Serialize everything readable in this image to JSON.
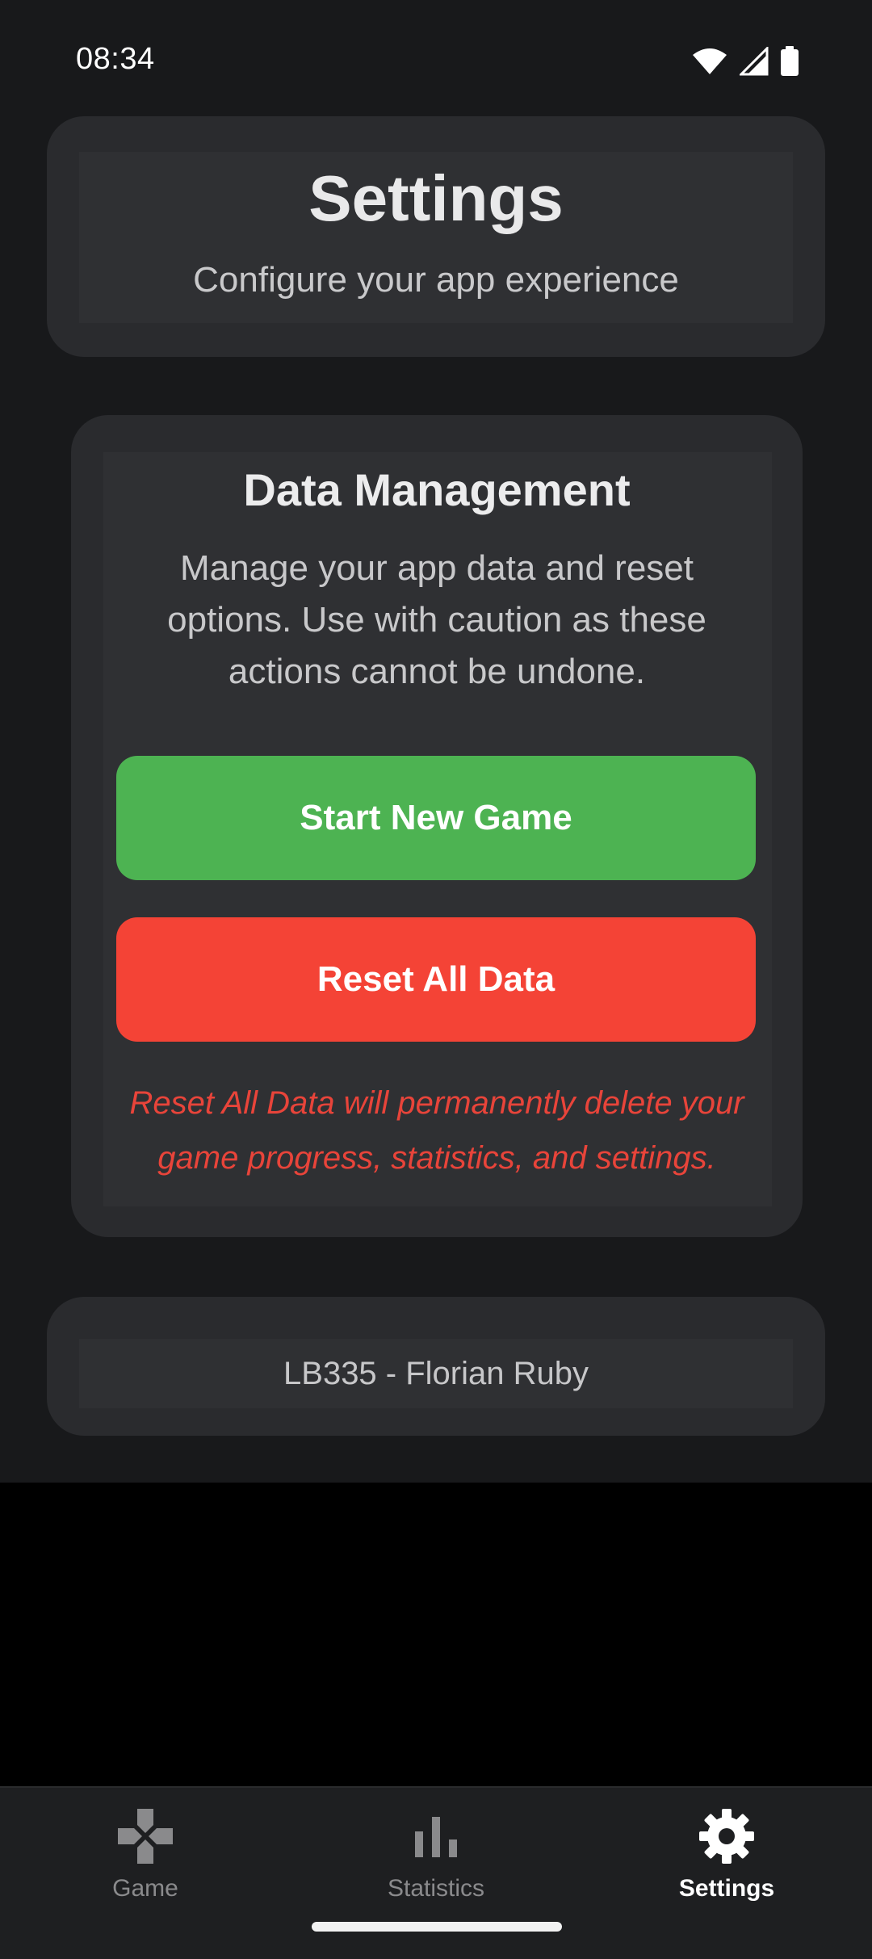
{
  "status_bar": {
    "time": "08:34",
    "icons": [
      "wifi-icon",
      "cellular-signal-icon",
      "battery-icon"
    ]
  },
  "header": {
    "title": "Settings",
    "subtitle": "Configure your app experience"
  },
  "data_management": {
    "title": "Data Management",
    "description": "Manage your app data and reset options. Use with caution as these actions cannot be undone.",
    "start_new_game_label": "Start New Game",
    "reset_all_data_label": "Reset All Data",
    "warning": "Reset All Data will permanently delete your game progress, statistics, and settings."
  },
  "footer": {
    "credit": "LB335 - Florian Ruby"
  },
  "bottom_nav": {
    "items": [
      {
        "label": "Game",
        "icon": "gamepad-icon",
        "active": false
      },
      {
        "label": "Statistics",
        "icon": "bar-chart-icon",
        "active": false
      },
      {
        "label": "Settings",
        "icon": "gear-icon",
        "active": true
      }
    ]
  },
  "colors": {
    "background": "#18191b",
    "card": "#2a2b2e",
    "start_button": "#4db352",
    "reset_button": "#f44336",
    "warning_text": "#e8443a",
    "nav_inactive": "#8a8a8c",
    "nav_active": "#ffffff"
  }
}
